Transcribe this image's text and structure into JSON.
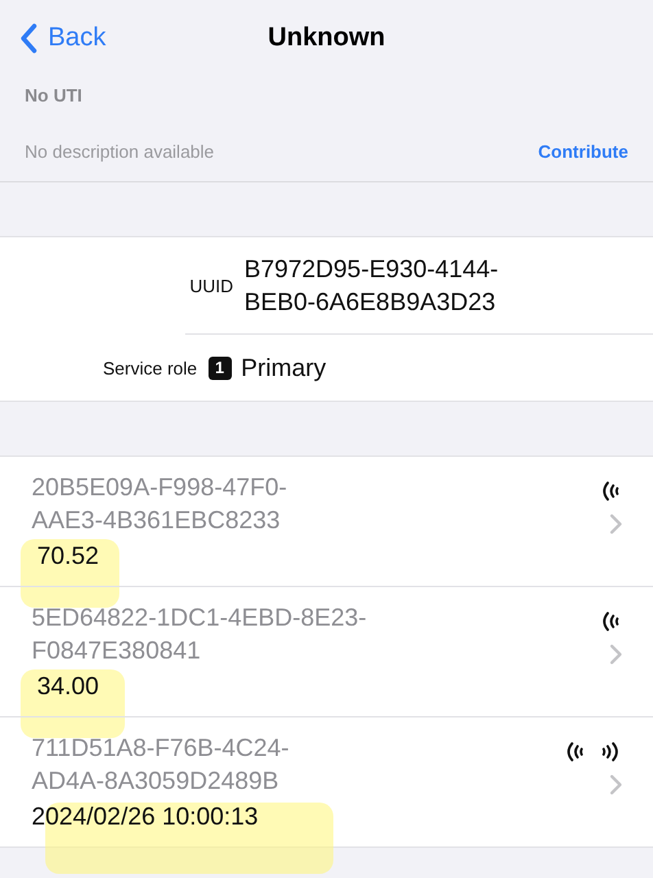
{
  "nav": {
    "back": "Back",
    "title": "Unknown"
  },
  "info": {
    "uti": "No UTI",
    "description": "No description available",
    "action": "Contribute"
  },
  "details": [
    {
      "label": "UUID",
      "value": "B7972D95-E930-4144-BEB0-6A6E8B9A3D23",
      "kind": "text"
    },
    {
      "label": "Service role",
      "value": "Primary",
      "badge": "1",
      "kind": "badge"
    }
  ],
  "characteristics": [
    {
      "uuid_lines": [
        "20B5E09A-F998-47F0-",
        "AAE3-4B361EBC8233"
      ],
      "value": "70.52",
      "outgoing": false,
      "highlighted": true
    },
    {
      "uuid_lines": [
        "5ED64822-1DC1-4EBD-8E23-",
        "F0847E380841"
      ],
      "value": "34.00",
      "outgoing": false,
      "highlighted": true
    },
    {
      "uuid_lines": [
        "711D51A8-F76B-4C24-",
        "AD4A-8A3059D2489B"
      ],
      "value": "2024/02/26 10:00:13",
      "outgoing": true,
      "highlighted": true
    }
  ]
}
